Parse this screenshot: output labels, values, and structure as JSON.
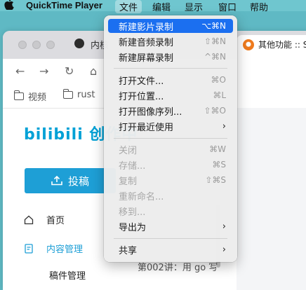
{
  "menubar": {
    "apple": "",
    "app_name": "QuickTime Player",
    "items": [
      "文件",
      "编辑",
      "显示",
      "窗口",
      "帮助"
    ]
  },
  "browser": {
    "tab1_label": "内核",
    "tab2_label": "其他功能 :: S",
    "bookmarks": [
      "视频",
      "rust"
    ],
    "nav": {
      "back": "←",
      "forward": "→",
      "reload": "↻",
      "home": "⌂"
    }
  },
  "page": {
    "logo": "bilibili 创作中",
    "upload_label": "投稿",
    "side_items": [
      "首页",
      "内容管理",
      "稿件管理"
    ],
    "row_text": "第002讲：用 go 写"
  },
  "menu": {
    "items": [
      {
        "label": "新建影片录制",
        "shortcut": "⌥⌘N"
      },
      {
        "label": "新建音频录制",
        "shortcut": "⇧⌘N"
      },
      {
        "label": "新建屏幕录制",
        "shortcut": "^⌘N"
      },
      {
        "label": "打开文件...",
        "shortcut": "⌘O"
      },
      {
        "label": "打开位置...",
        "shortcut": "⌘L"
      },
      {
        "label": "打开图像序列...",
        "shortcut": "⇧⌘O"
      },
      {
        "label": "打开最近使用",
        "shortcut": "›"
      },
      {
        "label": "关闭",
        "shortcut": "⌘W"
      },
      {
        "label": "存储...",
        "shortcut": "⌘S"
      },
      {
        "label": "复制",
        "shortcut": "⇧⌘S"
      },
      {
        "label": "重新命名...",
        "shortcut": ""
      },
      {
        "label": "移到...",
        "shortcut": ""
      },
      {
        "label": "导出为",
        "shortcut": "›"
      },
      {
        "label": "共享",
        "shortcut": "›"
      }
    ]
  },
  "colors": {
    "menu_highlight": "#1b6ff0",
    "bilibili_blue": "#00a1d6",
    "menubar": "#6fc6cf"
  }
}
